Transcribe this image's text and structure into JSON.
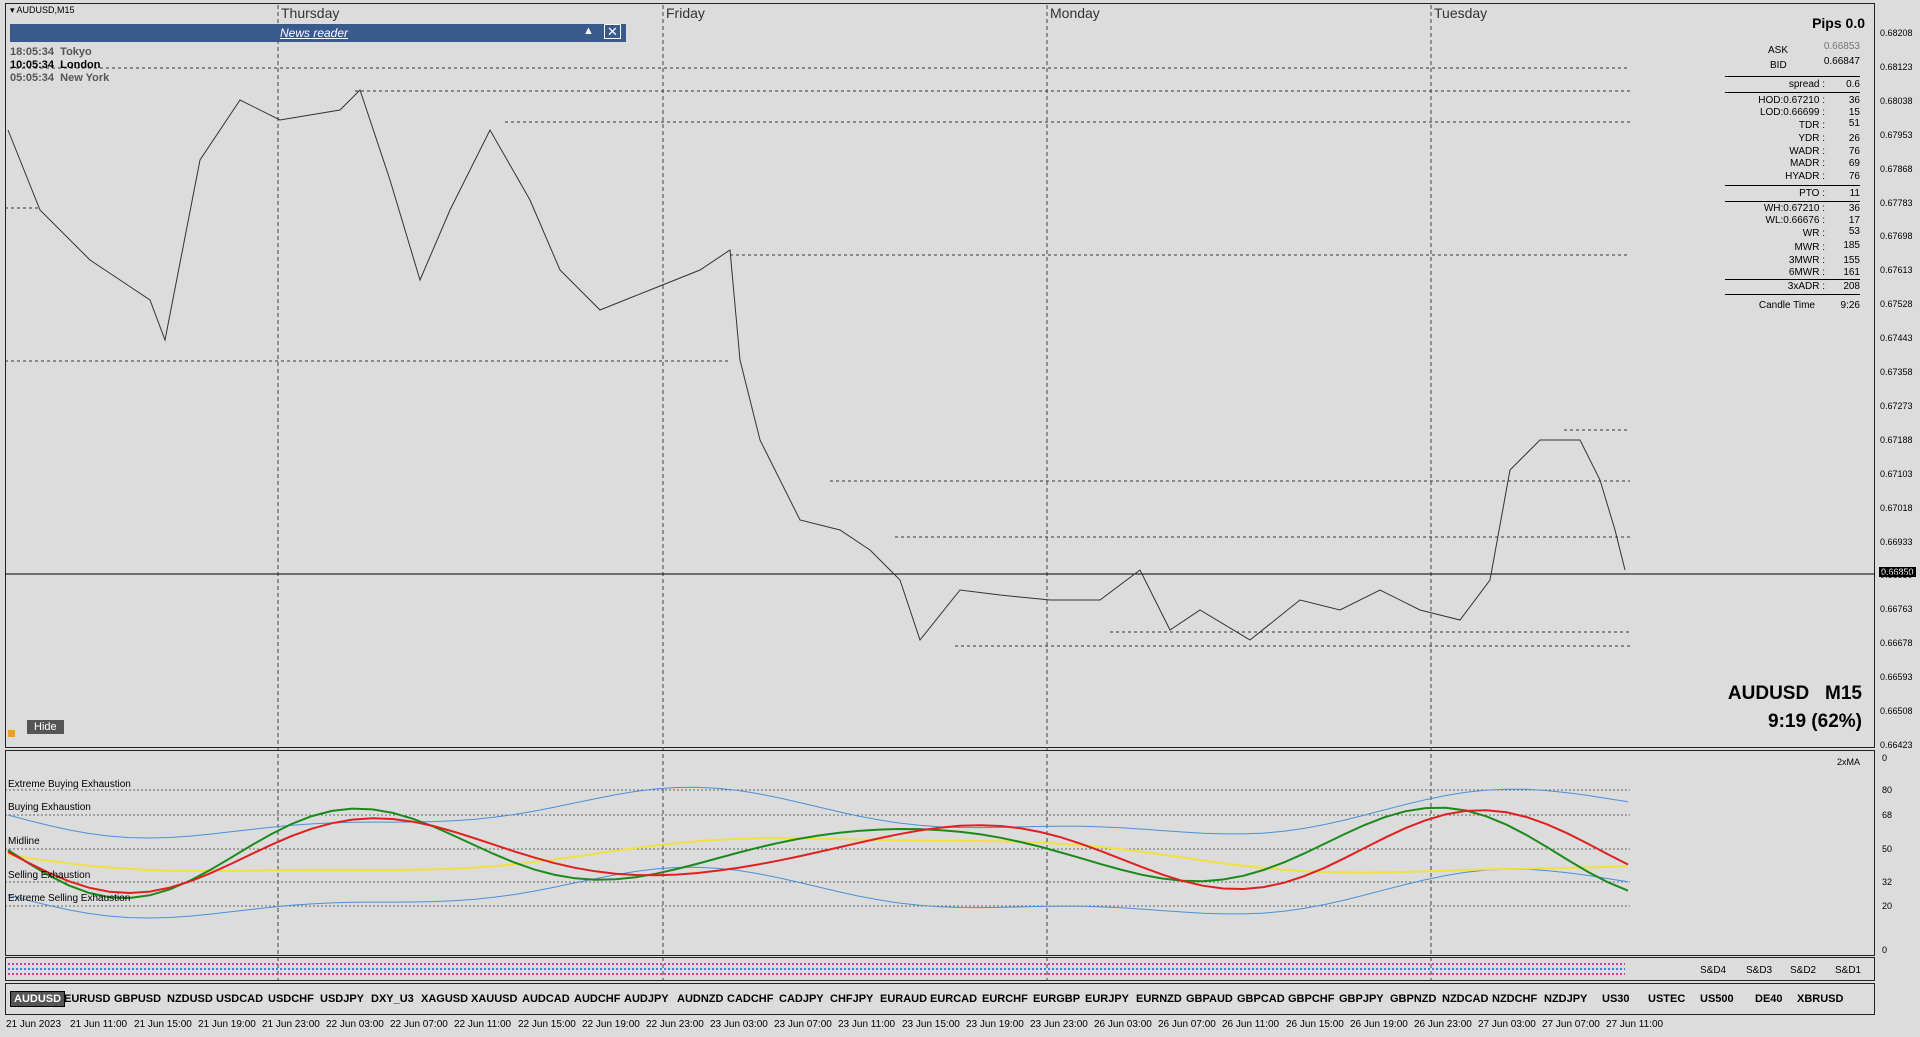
{
  "window": {
    "title": "AUDUSD,M15"
  },
  "news_reader": {
    "label": "News reader"
  },
  "days": [
    "Thursday",
    "Friday",
    "Monday",
    "Tuesday"
  ],
  "clocks": [
    {
      "time": "18:05:34",
      "city": "Tokyo"
    },
    {
      "time": "10:05:34",
      "city": "London"
    },
    {
      "time": "05:05:34",
      "city": "New York"
    }
  ],
  "info_panel": {
    "pips": "Pips 0.0",
    "ask_label": "ASK",
    "ask": "0.66853",
    "bid_label": "BID",
    "bid": "0.66847",
    "spread_label": "spread :",
    "spread": "0.6",
    "hod": "HOD:0.67210 :",
    "hod_v": "36",
    "lod": "LOD:0.66699 :",
    "lod_v": "15",
    "tdr": "TDR :",
    "tdr_v": "51",
    "ydr": "YDR :",
    "ydr_v": "26",
    "wadr": "WADR :",
    "wadr_v": "76",
    "madr": "MADR :",
    "madr_v": "69",
    "hyadr": "HYADR :",
    "hyadr_v": "76",
    "pto": "PTO :",
    "pto_v": "11",
    "wh": "WH:0.67210 :",
    "wh_v": "36",
    "wl": "WL:0.66676 :",
    "wl_v": "17",
    "wr": "WR :",
    "wr_v": "53",
    "mwr": "MWR :",
    "mwr_v": "185",
    "mwr3": "3MWR :",
    "mwr3_v": "155",
    "mwr6": "6MWR :",
    "mwr6_v": "161",
    "adr3": "3xADR :",
    "adr3_v": "208",
    "candle_time_label": "Candle Time",
    "candle_time": "9:26"
  },
  "symbol_display": {
    "symbol": "AUDUSD",
    "tf": "M15",
    "timer": "9:19 (62%)"
  },
  "hide_button": "Hide",
  "price_axis": [
    "0.68208",
    "0.68123",
    "0.68038",
    "0.67953",
    "0.67868",
    "0.67783",
    "0.67698",
    "0.67613",
    "0.67528",
    "0.67443",
    "0.67358",
    "0.67273",
    "0.67188",
    "0.67103",
    "0.67018",
    "0.66933",
    "0.66850",
    "0.66763",
    "0.66678",
    "0.66593",
    "0.66508",
    "0.66423"
  ],
  "current_price": "0.66850",
  "oscillator": {
    "levels": [
      "Extreme Buying Exhaustion",
      "Buying Exhaustion",
      "Midline",
      "Selling Exhaustion",
      "Extreme Selling Exhaustion"
    ],
    "axis": [
      "0",
      "80",
      "68",
      "50",
      "32",
      "20",
      "0"
    ],
    "ma_label": "2xMA"
  },
  "sd_labels": [
    "S&D4",
    "S&D3",
    "S&D2",
    "S&D1"
  ],
  "symbols": [
    "AUDUSD",
    "EURUSD",
    "GBPUSD",
    "NZDUSD",
    "USDCAD",
    "USDCHF",
    "USDJPY",
    "DXY_U3",
    "XAGUSD",
    "XAUUSD",
    "AUDCAD",
    "AUDCHF",
    "AUDJPY",
    "AUDNZD",
    "CADCHF",
    "CADJPY",
    "CHFJPY",
    "EURAUD",
    "EURCAD",
    "EURCHF",
    "EURGBP",
    "EURJPY",
    "EURNZD",
    "GBPAUD",
    "GBPCAD",
    "GBPCHF",
    "GBPJPY",
    "GBPNZD",
    "NZDCAD",
    "NZDCHF",
    "NZDJPY",
    "US30",
    "USTEC",
    "US500",
    "DE40",
    "XBRUSD"
  ],
  "timestamps": [
    "21 Jun 2023",
    "21 Jun 11:00",
    "21 Jun 15:00",
    "21 Jun 19:00",
    "21 Jun 23:00",
    "22 Jun 03:00",
    "22 Jun 07:00",
    "22 Jun 11:00",
    "22 Jun 15:00",
    "22 Jun 19:00",
    "22 Jun 23:00",
    "23 Jun 03:00",
    "23 Jun 07:00",
    "23 Jun 11:00",
    "23 Jun 15:00",
    "23 Jun 19:00",
    "23 Jun 23:00",
    "26 Jun 03:00",
    "26 Jun 07:00",
    "26 Jun 11:00",
    "26 Jun 15:00",
    "26 Jun 19:00",
    "26 Jun 23:00",
    "27 Jun 03:00",
    "27 Jun 07:00",
    "27 Jun 11:00"
  ]
}
